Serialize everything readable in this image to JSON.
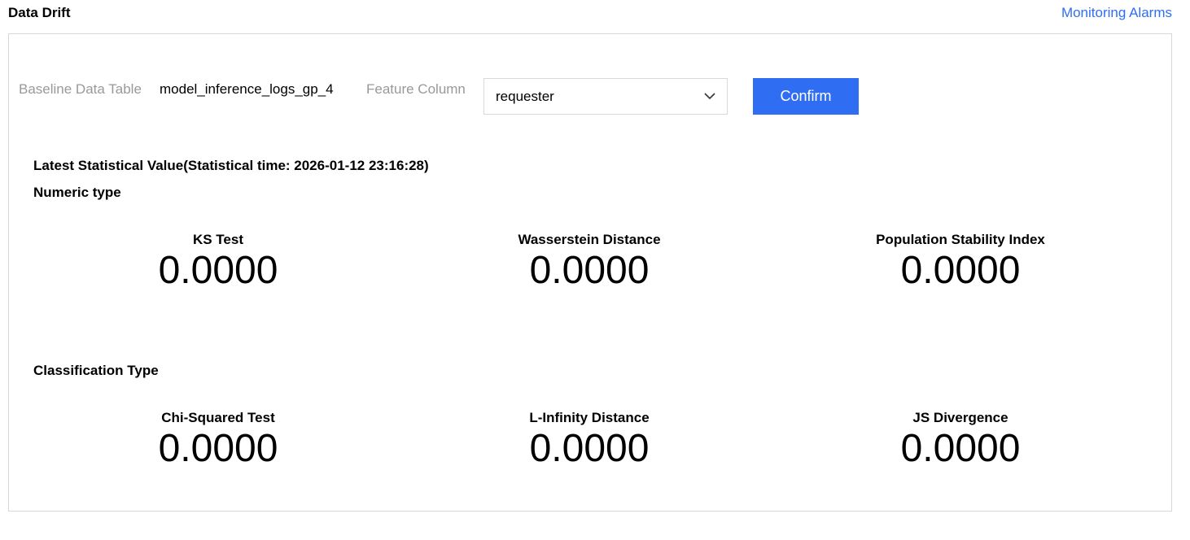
{
  "header": {
    "title": "Data Drift",
    "monitoring_link": "Monitoring Alarms"
  },
  "filters": {
    "baseline_label": "Baseline Data Table",
    "baseline_value": "model_inference_logs_gp_4",
    "feature_label": "Feature Column",
    "feature_selected": "requester",
    "confirm_label": "Confirm"
  },
  "stats": {
    "heading": "Latest Statistical Value(Statistical time: 2026-01-12 23:16:28)",
    "numeric": {
      "heading": "Numeric type",
      "metrics": [
        {
          "label": "KS Test",
          "value": "0.0000"
        },
        {
          "label": "Wasserstein Distance",
          "value": "0.0000"
        },
        {
          "label": "Population Stability Index",
          "value": "0.0000"
        }
      ]
    },
    "classification": {
      "heading": "Classification Type",
      "metrics": [
        {
          "label": "Chi-Squared Test",
          "value": "0.0000"
        },
        {
          "label": "L-Infinity Distance",
          "value": "0.0000"
        },
        {
          "label": "JS Divergence",
          "value": "0.0000"
        }
      ]
    }
  },
  "colors": {
    "accent": "#2f6ef3",
    "muted_label": "#999999",
    "border": "#d8d8d8"
  }
}
